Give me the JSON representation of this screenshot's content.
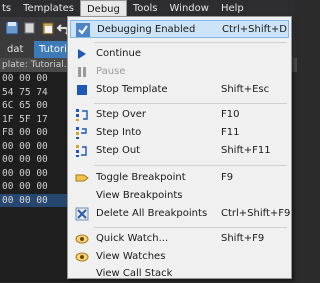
{
  "menubar": {
    "items": [
      {
        "label": "ts"
      },
      {
        "label": "Templates"
      },
      {
        "label": "Debug"
      },
      {
        "label": "Tools"
      },
      {
        "label": "Window"
      },
      {
        "label": "Help"
      }
    ]
  },
  "tabs": {
    "left_label": "dat",
    "active_label": "Tutorial"
  },
  "template_row": {
    "text": "plate: Tutorial.bt"
  },
  "hex": {
    "rows": [
      "00 00 00",
      "54 75 74",
      "6C 65 00",
      "1F 5F 17",
      "F8 00 00",
      "00 00 00",
      "00 00 00",
      "00 00 00",
      "00 00 00",
      "00 00 00",
      "",
      "",
      "",
      "",
      ""
    ]
  },
  "debug_menu": {
    "items": [
      {
        "label": "Debugging Enabled",
        "shortcut": "Ctrl+Shift+D",
        "icon": "checkmark-icon"
      },
      {
        "label": "Continue",
        "shortcut": "",
        "icon": "continue-icon"
      },
      {
        "label": "Pause",
        "shortcut": "",
        "icon": "pause-icon"
      },
      {
        "label": "Stop Template",
        "shortcut": "Shift+Esc",
        "icon": "stop-icon"
      },
      {
        "label": "Step Over",
        "shortcut": "F10",
        "icon": "step-over-icon"
      },
      {
        "label": "Step Into",
        "shortcut": "F11",
        "icon": "step-into-icon"
      },
      {
        "label": "Step Out",
        "shortcut": "Shift+F11",
        "icon": "step-out-icon"
      },
      {
        "label": "Toggle Breakpoint",
        "shortcut": "F9",
        "icon": "breakpoint-icon"
      },
      {
        "label": "View Breakpoints",
        "shortcut": "",
        "icon": ""
      },
      {
        "label": "Delete All Breakpoints",
        "shortcut": "Ctrl+Shift+F9",
        "icon": "delete-breakpoints-icon"
      },
      {
        "label": "Quick Watch...",
        "shortcut": "Shift+F9",
        "icon": "quick-watch-icon"
      },
      {
        "label": "View Watches",
        "shortcut": "",
        "icon": "view-watches-icon"
      },
      {
        "label": "View Call Stack",
        "shortcut": "",
        "icon": "call-stack-icon"
      }
    ]
  },
  "colors": {
    "menu_highlight": "#cde3f7",
    "tab_active": "#3d7ab8",
    "hex_selection": "#26476f"
  }
}
